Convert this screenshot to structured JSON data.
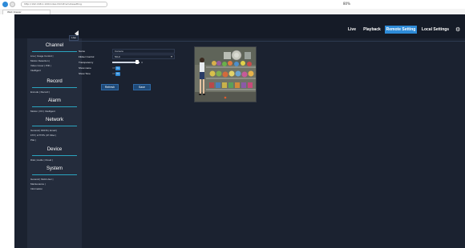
{
  "browser": {
    "address": "http://192.168.1.100/index.html#remotesetting",
    "zoom": "80%",
    "tab_title": "Web Viewer"
  },
  "topmenu": {
    "live": "Live",
    "playback": "Playback",
    "remote_setting": "Remote Setting",
    "local_settings": "Local Settings"
  },
  "sidebar": {
    "channel": {
      "title": "Channel",
      "items": [
        "Live | Image Control |",
        "Motion Detection |",
        "Video Cover | PIR |",
        "Intelligent"
      ]
    },
    "record": {
      "title": "Record",
      "items": [
        "Encode | Record |"
      ]
    },
    "alarm": {
      "title": "Alarm",
      "items": [
        "Motion | I/O | Intelligent"
      ]
    },
    "network": {
      "title": "Network",
      "items": [
        "General | DDNS | Email |",
        "FTP | HTTPS | IP Filter |",
        "Plat |"
      ]
    },
    "device": {
      "title": "Device",
      "items": [
        "Disk | Audio | Cloud |"
      ]
    },
    "system": {
      "title": "System",
      "items": [
        "General | Multi-User |",
        "Maintenance |",
        "Information"
      ]
    }
  },
  "content": {
    "tab": "Live",
    "fields": {
      "name_label": "Name",
      "name_value": "Camera",
      "flicker_label": "Flicker Control",
      "flicker_value": "50Hz",
      "transparency_label": "Transparency",
      "transparency_value": "4",
      "transparency_fraction": 0.9,
      "show_name_label": "Show name",
      "show_time_label": "Show Time",
      "toggle_off": "Off",
      "toggle_on": "On"
    },
    "refresh": "Refresh",
    "save": "Save"
  },
  "colors": {
    "accent": "#2e8bd8",
    "background": "#1b2230",
    "sidebar": "#242c3c",
    "section_line": "#2aa5c0"
  }
}
